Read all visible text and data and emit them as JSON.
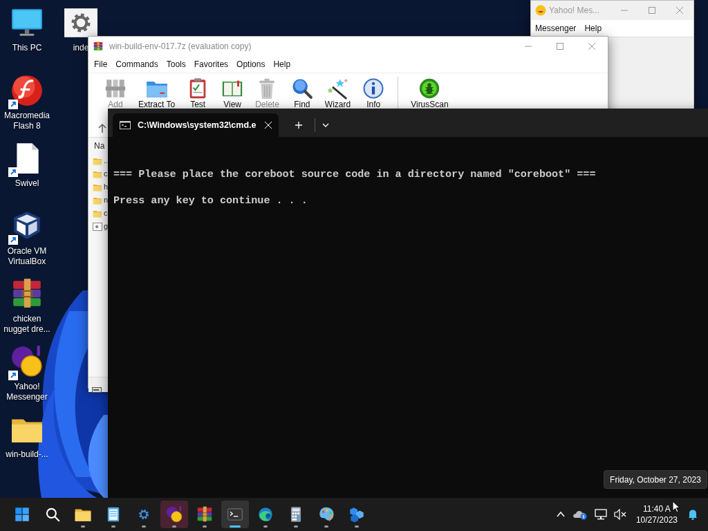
{
  "desktop": {
    "columns": [
      {
        "icons": [
          {
            "label": "This PC",
            "kind": "monitor",
            "shortcut": false
          },
          {
            "label": "Macromedia Flash 8",
            "kind": "flash",
            "shortcut": true
          },
          {
            "label": "Swivel",
            "kind": "document",
            "shortcut": true
          },
          {
            "label": "Oracle VM VirtualBox",
            "kind": "cube",
            "shortcut": true
          },
          {
            "label": "chicken nugget dre...",
            "kind": "archive",
            "shortcut": false
          },
          {
            "label": "Yahoo! Messenger",
            "kind": "yahoo",
            "shortcut": true
          },
          {
            "label": "win-build-...",
            "kind": "folder",
            "shortcut": false
          }
        ]
      },
      {
        "icons": [
          {
            "label": "inde",
            "kind": "gear_file",
            "shortcut": false
          }
        ]
      }
    ]
  },
  "yahoo_window": {
    "title": "Yahoo! Mes...",
    "menu": [
      "Messenger",
      "Help"
    ]
  },
  "archive_window": {
    "title": "win-build-env-017.7z (evaluation copy)",
    "menu": [
      "File",
      "Commands",
      "Tools",
      "Favorites",
      "Options",
      "Help"
    ],
    "toolbar": [
      {
        "label": "Add",
        "kind": "add",
        "disabled": true
      },
      {
        "label": "Extract To",
        "kind": "extract",
        "disabled": false
      },
      {
        "label": "Test",
        "kind": "test",
        "disabled": false
      },
      {
        "label": "View",
        "kind": "view",
        "disabled": false
      },
      {
        "label": "Delete",
        "kind": "delete",
        "disabled": true
      },
      {
        "label": "Find",
        "kind": "find",
        "disabled": false
      },
      {
        "label": "Wizard",
        "kind": "wizard",
        "disabled": false
      },
      {
        "label": "Info",
        "kind": "info",
        "disabled": false
      },
      {
        "label": "VirusScan",
        "kind": "virus",
        "disabled": false
      }
    ],
    "file_list": {
      "column_1": "Na",
      "rows": [
        {
          "name": "..",
          "kind": "folder"
        },
        {
          "name": "c",
          "kind": "folder"
        },
        {
          "name": "h",
          "kind": "folder"
        },
        {
          "name": "n",
          "kind": "folder"
        },
        {
          "name": "c",
          "kind": "folder"
        },
        {
          "name": "g",
          "kind": "file"
        }
      ]
    }
  },
  "terminal": {
    "tab": {
      "title": "C:\\Windows\\system32\\cmd.e"
    },
    "lines": [
      "=== Please place the coreboot source code in a directory named \"coreboot\" ===",
      "Press any key to continue . . ."
    ]
  },
  "taskbar": {
    "apps": [
      {
        "kind": "start",
        "running": false,
        "selected": false,
        "attention": false
      },
      {
        "kind": "search",
        "running": false,
        "selected": false,
        "attention": false
      },
      {
        "kind": "folder",
        "running": true,
        "selected": false,
        "attention": false
      },
      {
        "kind": "notepad",
        "running": true,
        "selected": false,
        "attention": false
      },
      {
        "kind": "settings",
        "running": true,
        "selected": false,
        "attention": false
      },
      {
        "kind": "yahoo",
        "running": true,
        "selected": false,
        "attention": true
      },
      {
        "kind": "archive",
        "running": true,
        "selected": false,
        "attention": false
      },
      {
        "kind": "terminal",
        "running": true,
        "selected": true,
        "attention": false
      },
      {
        "kind": "edge",
        "running": true,
        "selected": false,
        "attention": false
      },
      {
        "kind": "calculator",
        "running": true,
        "selected": false,
        "attention": false
      },
      {
        "kind": "paint",
        "running": true,
        "selected": false,
        "attention": false
      },
      {
        "kind": "cubes",
        "running": true,
        "selected": false,
        "attention": false
      }
    ],
    "clock": {
      "time": "11:40 A",
      "date": "10/27/2023"
    },
    "tooltip": "Friday, October 27, 2023"
  }
}
